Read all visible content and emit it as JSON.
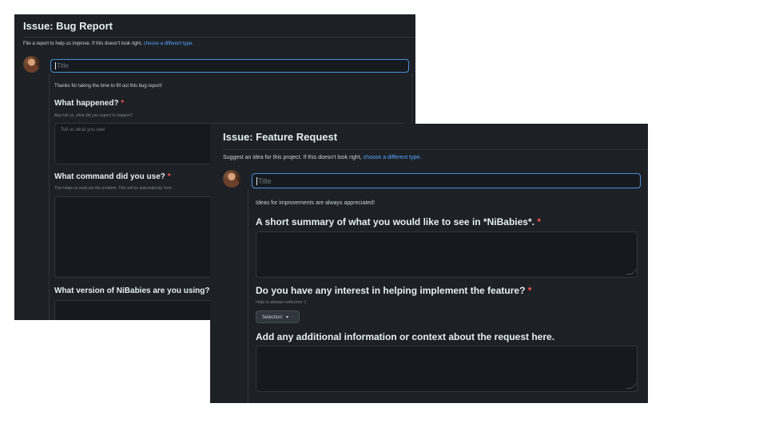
{
  "bug_report": {
    "title": "Issue: Bug Report",
    "subtitle": "File a report to help us improve. If this doesn't look right,",
    "subtitle_link": "choose a different type.",
    "title_placeholder": "Title",
    "intro": "Thanks for taking the time to fill out this bug report!",
    "q1": {
      "label": "What happened?",
      "required_mark": "*",
      "hint": "Also tell us, what did you expect to happen?",
      "placeholder": "Tell us what you see!"
    },
    "q2": {
      "label": "What command did you use?",
      "required_mark": "*",
      "hint": "This helps us replicate the problem. This will be automatically form"
    },
    "q3": {
      "label": "What version of NiBabies are you using?"
    }
  },
  "feature_request": {
    "title": "Issue: Feature Request",
    "subtitle": "Suggest an idea for this project. If this doesn't look right,",
    "subtitle_link": "choose a different type.",
    "title_placeholder": "Title",
    "intro": "Ideas for improvements are always appreciated!",
    "q1": {
      "label": "A short summary of what you would like to see in *NiBabies*.",
      "required_mark": "*"
    },
    "q2": {
      "label": "Do you have any interest in helping implement the feature?",
      "required_mark": "*",
      "hint": "Help is always welcome :)",
      "select_value": "Selection:",
      "select_arrow": "▾"
    },
    "q3": {
      "label": "Add any additional information or context about the request here."
    }
  },
  "colors": {
    "panel_bg": "#1d2126",
    "link": "#58a6ff",
    "required": "#f85149",
    "focus_border": "#4a8fd8"
  },
  "icons": [
    "avatar",
    "chevron-down-icon",
    "resize-grip-icon"
  ]
}
